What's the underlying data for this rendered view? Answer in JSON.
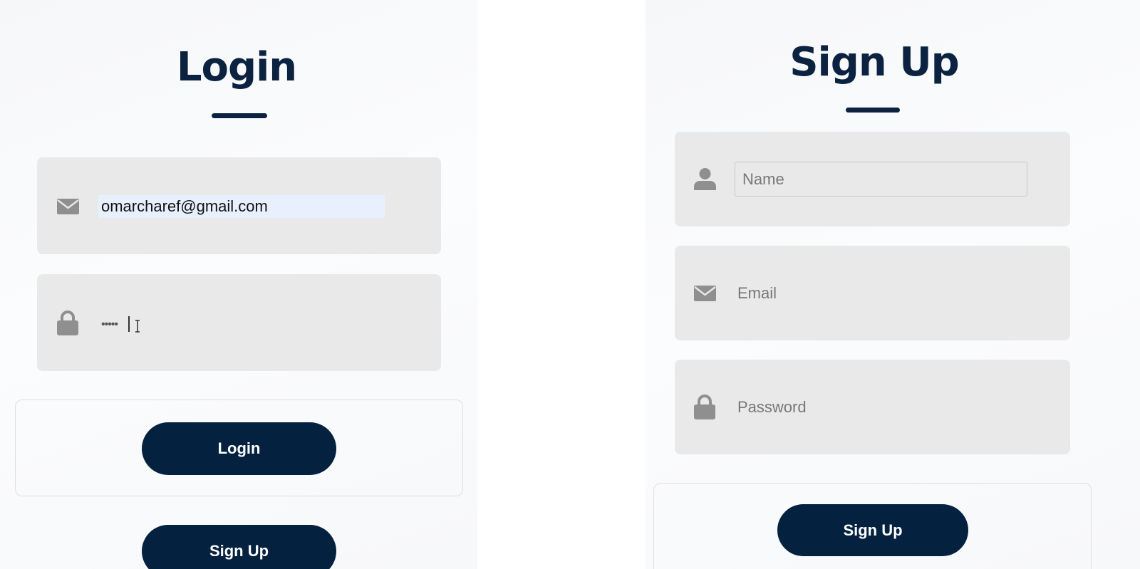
{
  "login": {
    "title": "Login",
    "email_icon": "envelope-icon",
    "email_value": "omarcharef@gmail.com",
    "password_icon": "lock-icon",
    "password_value": "•••••",
    "login_button_label": "Login",
    "signup_button_label": "Sign Up"
  },
  "signup": {
    "title": "Sign Up",
    "name_icon": "user-icon",
    "name_placeholder": "Name",
    "email_icon": "envelope-icon",
    "email_placeholder": "Email",
    "password_icon": "lock-icon",
    "password_placeholder": "Password",
    "signup_button_label": "Sign Up"
  },
  "colors": {
    "brand_navy": "#04213f",
    "field_bg": "#e9e9e9",
    "icon_gray": "#8f8f8f",
    "autofill_bg": "#e8f0fe"
  }
}
